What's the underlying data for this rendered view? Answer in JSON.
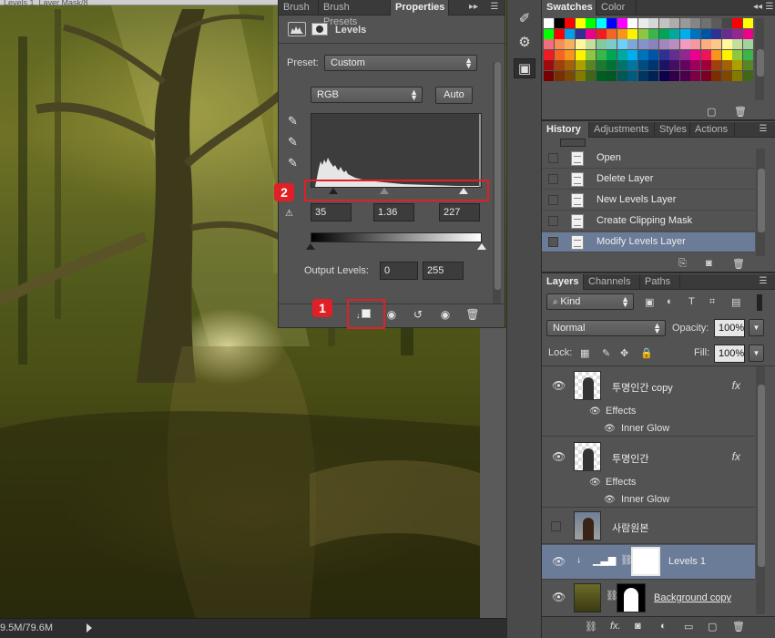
{
  "canvas": {
    "tab_text": "Levels 1, Layer Mask/8",
    "status_doc": "9.5M/79.6M"
  },
  "properties": {
    "tabs": [
      "Brush",
      "Brush Presets",
      "Properties"
    ],
    "title": "Levels",
    "preset_label": "Preset:",
    "preset_value": "Custom",
    "channel_value": "RGB",
    "auto_label": "Auto",
    "input_black": "35",
    "input_gamma": "1.36",
    "input_white": "227",
    "output_label": "Output Levels:",
    "output_black": "0",
    "output_white": "255",
    "annotation_1": "1",
    "annotation_2": "2"
  },
  "swatches": {
    "tabs": [
      "Swatches",
      "Color"
    ],
    "colors": [
      "#ffffff",
      "#000000",
      "#ff0000",
      "#ffff00",
      "#00ff00",
      "#00ffff",
      "#0000ff",
      "#ff00ff",
      "#ffffff",
      "#ebebeb",
      "#d6d6d6",
      "#c2c2c2",
      "#adadad",
      "#999999",
      "#858585",
      "#707070",
      "#5c5c5c",
      "#474747",
      "#ff0000",
      "#ffff00",
      "#00ff00",
      "#ff0000",
      "#00a0e8",
      "#2e3192",
      "#ec008c",
      "#ee1d24",
      "#f26522",
      "#f7941d",
      "#fff200",
      "#8dc63f",
      "#39b54a",
      "#00a651",
      "#00a99d",
      "#00aeef",
      "#0072bc",
      "#0054a6",
      "#2e3192",
      "#662d91",
      "#92278f",
      "#ec008c",
      "#f26d7d",
      "#f68e56",
      "#fbaf5d",
      "#fff799",
      "#c4df9b",
      "#82ca9c",
      "#7accc8",
      "#6dcff6",
      "#7ea7d8",
      "#8493ca",
      "#8882be",
      "#a187be",
      "#bd8cbf",
      "#f49ac1",
      "#f5989d",
      "#f9ad81",
      "#fdc68a",
      "#fff79a",
      "#c4df9b",
      "#a3d39c",
      "#ed1c24",
      "#f26522",
      "#f7941d",
      "#fff200",
      "#8dc63f",
      "#39b54a",
      "#00a651",
      "#00a99d",
      "#00aeef",
      "#0072bc",
      "#0054a6",
      "#2e3192",
      "#662d91",
      "#92278f",
      "#ec008c",
      "#ed145b",
      "#f7941d",
      "#fff200",
      "#8dc63f",
      "#39b54a",
      "#9e0b0f",
      "#a0410d",
      "#a36209",
      "#aba000",
      "#598527",
      "#1a7b30",
      "#007236",
      "#00746b",
      "#0076a3",
      "#004b80",
      "#003471",
      "#1b1464",
      "#440e62",
      "#630460",
      "#9e005d",
      "#9e0039",
      "#a0410d",
      "#a36209",
      "#aba000",
      "#598527",
      "#790000",
      "#7b2e00",
      "#7d4900",
      "#827b00",
      "#406618",
      "#005e20",
      "#005826",
      "#005952",
      "#005b7f",
      "#003663",
      "#002157",
      "#0d004c",
      "#32004b",
      "#4b0049",
      "#7b0046",
      "#7a0026",
      "#7b2e00",
      "#7d4900",
      "#827b00",
      "#406618"
    ]
  },
  "history": {
    "tabs": [
      "History",
      "Adjustments",
      "Styles",
      "Actions"
    ],
    "items": [
      "Open",
      "Delete Layer",
      "New Levels Layer",
      "Create Clipping Mask",
      "Modify Levels Layer"
    ]
  },
  "layers": {
    "tabs": [
      "Layers",
      "Channels",
      "Paths"
    ],
    "kind_value": "Kind",
    "blend_mode": "Normal",
    "opacity_label": "Opacity:",
    "opacity_value": "100%",
    "lock_label": "Lock:",
    "fill_label": "Fill:",
    "fill_value": "100%",
    "fx_label": "fx",
    "effects_label": "Effects",
    "inner_glow_label": "Inner Glow",
    "items": [
      {
        "name": "투명인간 copy"
      },
      {
        "name": "투명인간"
      },
      {
        "name": "사람원본"
      },
      {
        "name": "Levels 1"
      },
      {
        "name": "Background copy"
      }
    ]
  }
}
